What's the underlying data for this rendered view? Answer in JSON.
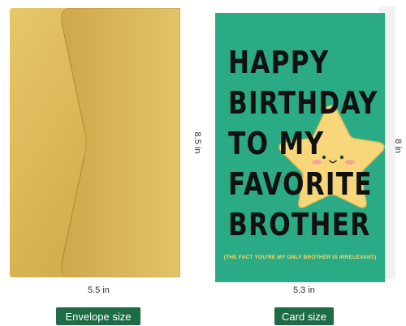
{
  "card": {
    "headline_lines": [
      "HAPPY",
      "BIRTHDAY",
      "TO MY",
      "FAVORITE",
      "BROTHER"
    ],
    "subline": "(THE FACT YOU'RE MY ONLY BROTHER IS IRRELEVANT)"
  },
  "dimensions": {
    "envelope_width": "5.5 in",
    "envelope_height": "8.5 in",
    "card_width": "5.3 in",
    "card_height": "8 in"
  },
  "labels": {
    "envelope": "Envelope size",
    "card": "Card size"
  },
  "colors": {
    "envelope_gold": "#d9b352",
    "card_green": "#2bab85",
    "star_yellow": "#f7d77a",
    "tag_green": "#1e6b48"
  }
}
